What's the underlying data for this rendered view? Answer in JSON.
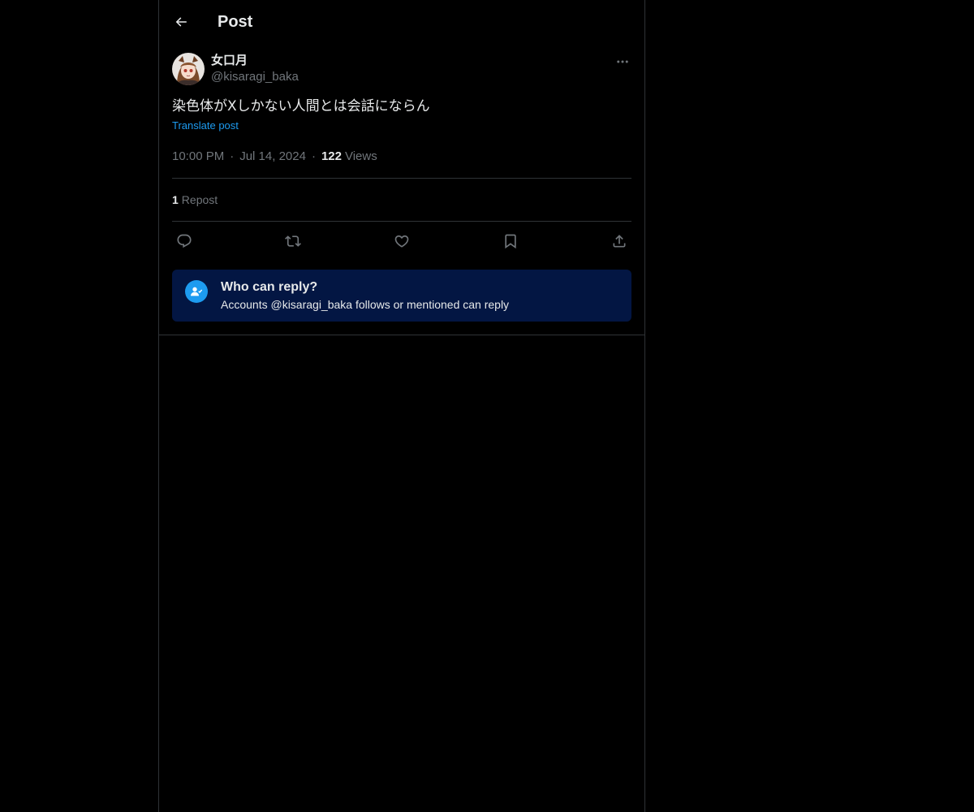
{
  "header": {
    "title": "Post",
    "back_icon": "arrow-left-icon"
  },
  "author": {
    "name": "女口月",
    "handle": "@kisaragi_baka",
    "avatar_icon": "avatar-image"
  },
  "post": {
    "text": "染色体がXしかない人間とは会話にならん",
    "translate_label": "Translate post",
    "time": "10:00 PM",
    "date": "Jul 14, 2024",
    "views_count": "122",
    "views_label": "Views",
    "separator": "·"
  },
  "stats": {
    "repost_count": "1",
    "repost_label": "Repost"
  },
  "actions": [
    "reply-icon",
    "repost-icon",
    "like-icon",
    "bookmark-icon",
    "share-icon"
  ],
  "reply_restriction": {
    "title": "Who can reply?",
    "description": "Accounts @kisaragi_baka follows or mentioned can reply"
  },
  "colors": {
    "background": "#000000",
    "accent": "#1d9bf0",
    "reply_box": "#031643",
    "muted_text": "#71767b",
    "border": "#2f3336"
  }
}
